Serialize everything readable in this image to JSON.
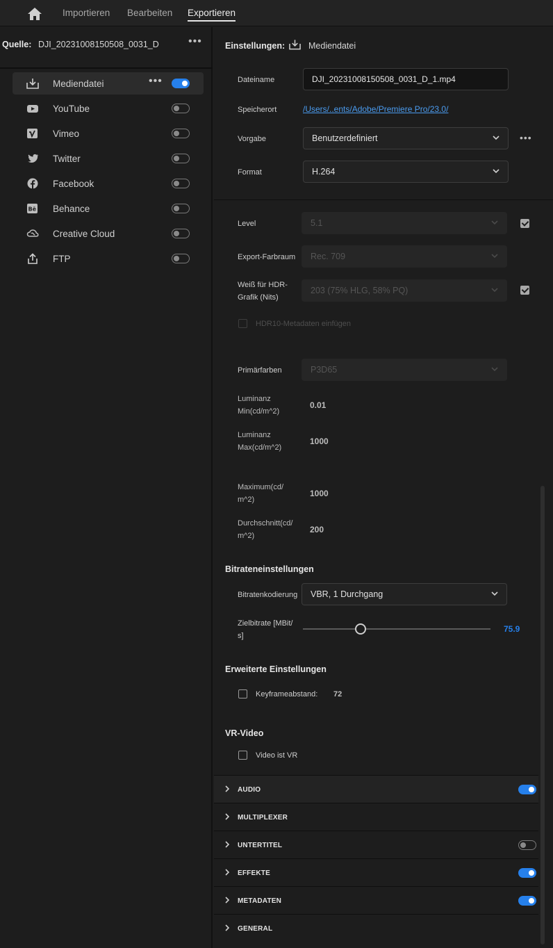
{
  "nav": {
    "tabs": [
      {
        "label": "Importieren"
      },
      {
        "label": "Bearbeiten"
      },
      {
        "label": "Exportieren"
      }
    ]
  },
  "source": {
    "label": "Quelle:",
    "name": "DJI_20231008150508_0031_D"
  },
  "destinations": [
    {
      "label": "Mediendatei",
      "icon": "download-icon",
      "enabled": true,
      "selected": true
    },
    {
      "label": "YouTube",
      "icon": "youtube-icon",
      "enabled": false
    },
    {
      "label": "Vimeo",
      "icon": "vimeo-icon",
      "enabled": false
    },
    {
      "label": "Twitter",
      "icon": "twitter-icon",
      "enabled": false
    },
    {
      "label": "Facebook",
      "icon": "facebook-icon",
      "enabled": false
    },
    {
      "label": "Behance",
      "icon": "behance-icon",
      "enabled": false
    },
    {
      "label": "Creative Cloud",
      "icon": "creative-cloud-icon",
      "enabled": false
    },
    {
      "label": "FTP",
      "icon": "upload-icon",
      "enabled": false
    }
  ],
  "settings": {
    "header": "Einstellungen:",
    "target": "Mediendatei",
    "filename_label": "Dateiname",
    "filename": "DJI_20231008150508_0031_D_1.mp4",
    "location_label": "Speicherort",
    "location": "/Users/..ents/Adobe/Premiere Pro/23.0/",
    "preset_label": "Vorgabe",
    "preset": "Benutzerdefiniert",
    "format_label": "Format",
    "format": "H.264"
  },
  "video": {
    "level_label": "Level",
    "level": "5.1",
    "level_checked": true,
    "colorspace_label": "Export-Farbraum",
    "colorspace": "Rec. 709",
    "hdr_white_label_1": "Weiß für HDR-",
    "hdr_white_label_2": "Grafik (Nits)",
    "hdr_white": "203 (75% HLG, 58% PQ)",
    "hdr_white_checked": true,
    "hdr10_label": "HDR10-Metadaten einfügen",
    "primaries_label": "Primärfarben",
    "primaries": "P3D65",
    "lum_min_label_1": "Luminanz",
    "lum_min_label_2": "Min(cd/m^2)",
    "lum_min": "0.01",
    "lum_max_label_1": "Luminanz",
    "lum_max_label_2": "Max(cd/m^2)",
    "lum_max": "1000",
    "maximum_label_1": "Maximum(cd/",
    "maximum_label_2": "m^2)",
    "maximum": "1000",
    "average_label_1": "Durchschnitt(cd/",
    "average_label_2": "m^2)",
    "average": "200"
  },
  "bitrate": {
    "header": "Bitrateneinstellungen",
    "encoding_label": "Bitratenkodierung",
    "encoding": "VBR, 1 Durchgang",
    "target_label_1": "Zielbitrate [MBit/",
    "target_label_2": "s]",
    "target": "75.9"
  },
  "advanced": {
    "header": "Erweiterte Einstellungen",
    "keyframe_label": "Keyframeabstand:",
    "keyframe": "72"
  },
  "vr": {
    "header": "VR-Video",
    "vr_label": "Video ist VR"
  },
  "sections": [
    {
      "label": "AUDIO",
      "toggle": "on"
    },
    {
      "label": "MULTIPLEXER",
      "toggle": "none"
    },
    {
      "label": "UNTERTITEL",
      "toggle": "off"
    },
    {
      "label": "EFFEKTE",
      "toggle": "on"
    },
    {
      "label": "METADATEN",
      "toggle": "on"
    },
    {
      "label": "GENERAL",
      "toggle": "none"
    }
  ],
  "colors": {
    "accent": "#2680eb",
    "link": "#4b9cf0",
    "background": "#1d1d1d"
  }
}
